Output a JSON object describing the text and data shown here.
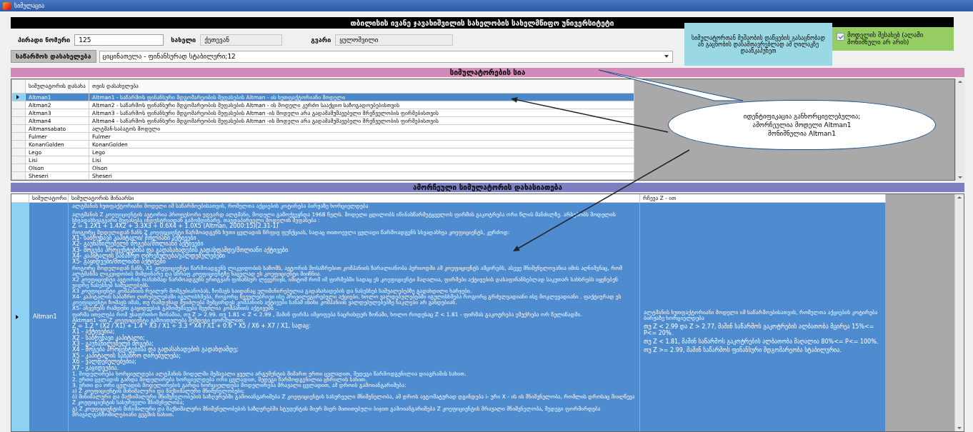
{
  "window": {
    "title": "სიმულაცია"
  },
  "header": {
    "title": "თბილისის ივანე ჯავახიშვილის სახელობის სახელმწიფო უნივერსიტეტი"
  },
  "form": {
    "fields": [
      {
        "label": "პირადი ნომერი",
        "value": "125",
        "kind": "editable"
      },
      {
        "label": "სახელი",
        "value": "ქეთევან",
        "kind": "readonly"
      },
      {
        "label": "გვარი",
        "value": "ყულოშვილი",
        "kind": "readonly"
      }
    ],
    "company": {
      "label": "საწარმოს დასახელება",
      "value": "ციცინათელა - ფინანსურად სტაბილური;12"
    }
  },
  "info_note": "სიმულატორთან მუშაობის დაწყების გასაცნობად ან გაცნობის დასამთავრებლად ამ ღილაკზე დააწკაპუნეთ",
  "about_checkbox": {
    "label": "მოდელის შესახებ (ალამი მონიშნული არ არის)",
    "checked": true
  },
  "simulators": {
    "title": "სიმულატორების სია",
    "columns": [
      "სიმულატორის დასახა",
      "თვის დასახელება"
    ],
    "rows": [
      {
        "name": "Altman1",
        "description": "Altman1 - საწარმოს ფინანსური მდგომარეობის შეფასების  Altman - ის ხუთფაქტორიანი მოდელი",
        "selected": true
      },
      {
        "name": "Altman2",
        "description": "Altman2 - საწარმოს ფინანსური მდგომარეობის შეფასების Altman - ის მოდელი კერძო სააქციო საზოგადოებებისთვის",
        "selected": false
      },
      {
        "name": "Altman3",
        "description": "Altman3 - საწარმოს ფინანსური მდგომარეობის შეფასების Altman -ის  მოდელი არა გადამამუშავებელი მრეწველობის ფირმებისთვის",
        "selected": false
      },
      {
        "name": "Altman4",
        "description": "Altman4 - საწარმოს ფინანსური მდგომარეობის შეფასების Altman -ის  მოდელი არა გადამამუშავებელი მრეწველობის ფირმებისთვის",
        "selected": false
      },
      {
        "name": "Altmansabato",
        "description": "ალტმან-საბატოს მოდელი",
        "selected": false
      },
      {
        "name": "Fulmer",
        "description": "Fulmer",
        "selected": false
      },
      {
        "name": "KonanGolden",
        "description": "KonanGolden",
        "selected": false
      },
      {
        "name": "Lego",
        "description": "Lego",
        "selected": false
      },
      {
        "name": "Lisi",
        "description": "Lisi",
        "selected": false
      },
      {
        "name": "Olson",
        "description": "Olson",
        "selected": false
      },
      {
        "name": "Sheseri",
        "description": "Sheseri",
        "selected": false
      }
    ]
  },
  "callout": {
    "lines": [
      "იდენტიფიკაცია განხორციელებულია;",
      "ამორჩეულია მოდელი Altman1",
      "მონიშნულია Altman1"
    ]
  },
  "details": {
    "title": "ამორჩეული  სიმულატორის  დახასიათება",
    "columns": [
      "სიმულატორი",
      "სიმულატორის შინაარსი",
      "რჩევა Z - ით"
    ],
    "row": {
      "name": "Altman1",
      "selected": true,
      "content": [
        {
          "kind": "heading",
          "text": "ალტმანის ხუთფაქტორიანი მოდელი იმ საწარმოებისათვის, რომელთა აქციების კოტირება ბირჟაზე ხორციელდება"
        },
        {
          "kind": "text",
          "text": "ალტმანის Z კოეფიციენტის ავტორია პროფესორი ედვარდ ალტმანი, მოდელი გამოქვეყნდა 1968 წელს. მოდელი ცდილობს იწინასწარმეტყველოს ფირმის გაკოტრება ორი წლის მანძილზე. არსებობს მოდელის სხვადასხვაგვარი შეფასება ინდუსტრიიდან გამომდინარე. თავდაპირველი მოდელის შეფასება :"
        },
        {
          "kind": "formula",
          "text": "Z = 1.2X1 + 1.4X2 + 3.3X3 + 0.6X4 + 1.0X5   (Altman, 2000:15)(2.31-1)"
        },
        {
          "kind": "text",
          "text": "როგორც მოდელიდან ჩანს Z კოეფიციენტი წარმოადგენს ხუთი ცვლადის წრფივ ფუნქციას, სადაც თითოეული ცვლადი წარმოადგენს სხვადასხვა კოეფიციენტს, კერძოდ:"
        },
        {
          "kind": "formula",
          "text": "X1- საბრუნავი კაპიტალი/ მთლიანი აქტივები"
        },
        {
          "kind": "formula",
          "text": "X2- გაუნაწილებელი მოგება/მთლიანი აქტივები"
        },
        {
          "kind": "formula",
          "text": "X3- მოგება პროცენტებისა და გადასახადების გადახდამდე/მთლიანი აქტივები"
        },
        {
          "kind": "formula",
          "text": "X4- კაპიტალის საბაზრო ღირებულება/ვალდებულებები"
        },
        {
          "kind": "formula",
          "text": "X5- გაყიდვები/მთლიანი აქტივები"
        },
        {
          "kind": "text",
          "text": "როგორც მოდელიდან ჩანს, X1 კოეფიციენტი წარმოადგენს ლიკვიდობის საზომს, ავტორის მოსაზრებით კომპანიის ზარალიანობა პერიოდში ამ კოეფიციენტს ამცირებს, ასევე მნიშვნელოვანია იმის აღნიშვნაც, რომ ალტმანმა ლიკვიდობის მიმდინარე და სწრაფ კოეფიციენტზე ნაცვლად ეს კოეფიციენტი მიიჩნია."
        },
        {
          "kind": "text",
          "text": "X2 კოეფიციენტი ავტორის თანახმად წარმოადგენს ერთგვარ ფინანსურ ლევერიჯს, იმიტომ რომ იმ ფირმებში სადაც ეს კოეფიციენტი მაღალია, ფირმები აქტივების დასაფინანსებლად საკუთარ სახსრებს იყენებენ ვიდრე ნასესხებ საშუალებებს."
        },
        {
          "kind": "text",
          "text": "X3 კოეფიციენტი კომპანიის რეალურ მომგებიანობას, ზომავს საიდანაც ელიმინირებულია გადასახადების და ნასესხებ საშუალებებზე გადახდილი ხარჯები."
        },
        {
          "kind": "text",
          "text": "X4- კაპიტალის საბაზრო ღირებულებაში იგულისხმება, როგორც ჩვეულებრივი ისე პრივილეგირებული აქციები, ხოლო ვალდებულებებში იგულისხმება როგორც გრძელვადიანი ისე მოკლევადიანი . ფაქტიურად ეს კოეფიციენტი ზომავს იმას, თუ რამდენად შეიძლება შემცირდეს კომპანიის აქტივები სანამ ისინი კომპანიის ვალდებულებებზე ნაკლები არ გახდებიან."
        },
        {
          "kind": "text",
          "text": "X5- აჩვენებს რამდენი გაყიდვების გამომუშავება შეუძლია კომპანიის აქტივებს ."
        },
        {
          "kind": "text",
          "text": "ფირმა ითვლება რომ უსაფრთხო ზონაშია, თუ  Z > 2.99. თუ   1.81 < Z < 2.99 , მაშინ ფირმა იმყოფება ნაცრისფერ ზონაში, ხოლო როდესაც  Z < 1.81 -  ფირმას გაკოტრება ემუქრება ორ წელიწადში."
        },
        {
          "kind": "text",
          "text": "Aktman1 -ით Z კოეფიციენტი გამოითვლება შემდეგი ფორმულით:"
        },
        {
          "kind": "formula",
          "text": "Z = 1.2 * (X2 / X1) + 1.4 * X3 / X1 + 3.3 * X4 / X1 + 0.6 * X5 / X6 + X7 / X1, სადაც:"
        },
        {
          "kind": "formula",
          "text": "X1 - აქტივებია;"
        },
        {
          "kind": "formula",
          "text": "X2 - საბრუნავი კაპიტალი;"
        },
        {
          "kind": "formula",
          "text": "X3 - გაუნაწილებელი მოგება;"
        },
        {
          "kind": "formula",
          "text": "X4 - მოგება პროცენტებისა და გადასახადების გადახდამდე;"
        },
        {
          "kind": "formula",
          "text": "X5 - კაპიტალის საბაზრო ღირებულება;"
        },
        {
          "kind": "formula",
          "text": "X6 - ვალდებულებებია;"
        },
        {
          "kind": "formula",
          "text": "X7 - გაყიდვებია."
        },
        {
          "kind": "text",
          "text": "1. მოდელირება ხორციელდება ალტმანის მოდელში შემავალი ყველა არგუმენტის მიმართ ერთი ცვლადით, შედეგი წარმოდგენილია დიაგრამის სახით."
        },
        {
          "kind": "text",
          "text": "2. ერთი ცვლადის გარდა მოდელირება ხორციელდება ორი ცვლადით, შედეგი წარმოდგენილია ცხრილის სახით."
        },
        {
          "kind": "text",
          "text": "3. ერთი და ორი ცვლადის მოდელირების გარდა ხორციელდება მოდელირება მრავალი ცვლადით, ამ დროის გამოიანგარიშება:"
        },
        {
          "kind": "text",
          "text": "ა) Z კოეფიციენტის მინიმალური და მაქსიმალური მნიშვნელობები;"
        },
        {
          "kind": "text",
          "text": "ბ) მინიმალური და მაქსიმალური მნიშვნელობების საზღვრებში გამოიანგარიშება Z კოეფიციენტის სასურველი მნიშვნელობა, ამ დროს ავტომატურად დგინდება i- ური X - ის ის მნიშვნელობა, რომლის დროსაც მიიღწევა Z კოეფიციენტის სასურველი მნიშვნელობა;"
        },
        {
          "kind": "text",
          "text": "გ) Z კოეფიციენტის მინიმალური და მაქსიმალური მნიშვნელობების საზღვრებში  სტუდენტის მიერ მიერ მითითებული ბიჯით გამოიანგარიშება Z კოეფიციენტის მრავალი მნიშვნელობა, შედეგი ფორმირდება მრავალგანზომილებიანი გეგმის სახით."
        }
      ],
      "advice": [
        {
          "kind": "text",
          "text": "ალტმანის ხუთფაქტორიანი მოდელი იმ საწარმოებისათვის, რომელთა აქციების კოტირება ბირჟაზე ხორციელდება"
        },
        {
          "kind": "formula",
          "text": "თუ Z < 2.99 და  Z > 2.77, მაშინ  საწარმოს გაკოტრების ალბათობა მცირეა 15%<= P<= 20%."
        },
        {
          "kind": "formula",
          "text": "თუ  Z < 1.81, მაშინ საწარმოს გაკოტრების ალბათობა მაღალია  80%<= P<= 100%."
        },
        {
          "kind": "formula",
          "text": "თუ  Z >= 2.99, მაშინ საწარმოს ფინანსური მდგომარეობა სტაბილურია."
        }
      ]
    }
  }
}
